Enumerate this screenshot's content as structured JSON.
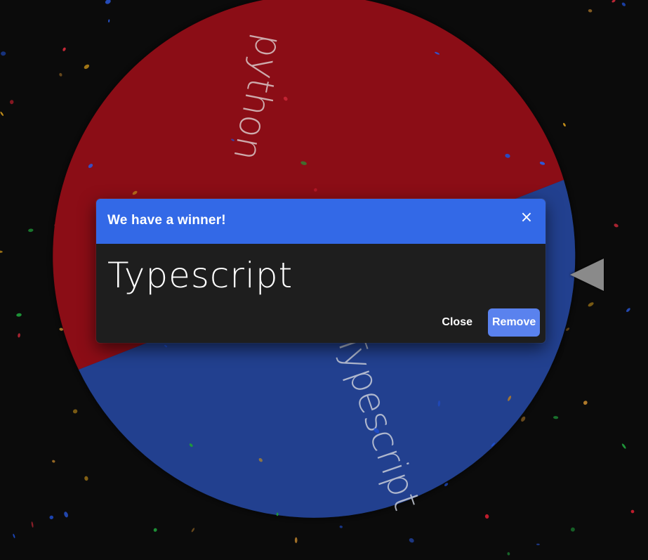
{
  "wheel": {
    "segments": [
      {
        "label": "python",
        "color": "#8b0a17"
      },
      {
        "label": "Typescript",
        "color": "#21418f"
      }
    ]
  },
  "dialog": {
    "title": "We have a winner!",
    "close_icon": "×",
    "winner": "Typescript",
    "close_label": "Close",
    "remove_label": "Remove",
    "header_color": "#3369e7",
    "remove_color": "#5a82ee"
  },
  "pointer": {
    "icon": "triangle-left-icon",
    "color": "#8a8a8a"
  }
}
